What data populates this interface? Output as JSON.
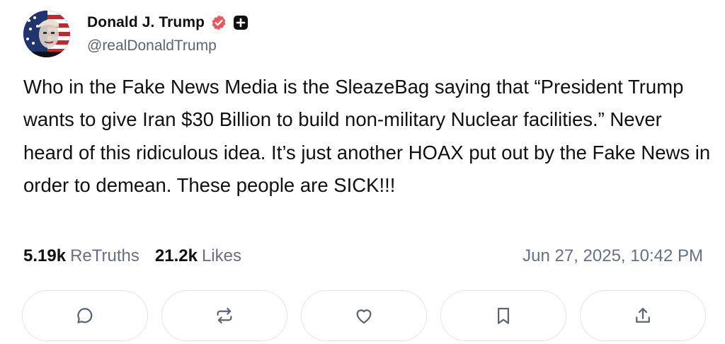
{
  "author": {
    "display_name": "Donald J. Trump",
    "handle": "@realDonaldTrump",
    "avatar_icon": "avatar-image",
    "verified_icon": "verified-badge-icon",
    "verified_color": "#e8585f"
  },
  "post": {
    "text": "Who in the Fake News Media is the SleazeBag saying that “President Trump wants to give Iran $30 Billion to build non-military Nuclear facilities.” Never heard of this ridiculous idea. It’s just another HOAX put out by the Fake News in order to demean. These people are SICK!!!",
    "retruths_count": "5.19k",
    "retruths_label": "ReTruths",
    "likes_count": "21.2k",
    "likes_label": "Likes",
    "timestamp": "Jun 27, 2025, 10:42 PM"
  },
  "actions": [
    {
      "name": "reply",
      "icon": "comment-icon"
    },
    {
      "name": "retruth",
      "icon": "repost-icon"
    },
    {
      "name": "like",
      "icon": "heart-icon"
    },
    {
      "name": "bookmark",
      "icon": "bookmark-icon"
    },
    {
      "name": "share",
      "icon": "share-icon"
    }
  ]
}
